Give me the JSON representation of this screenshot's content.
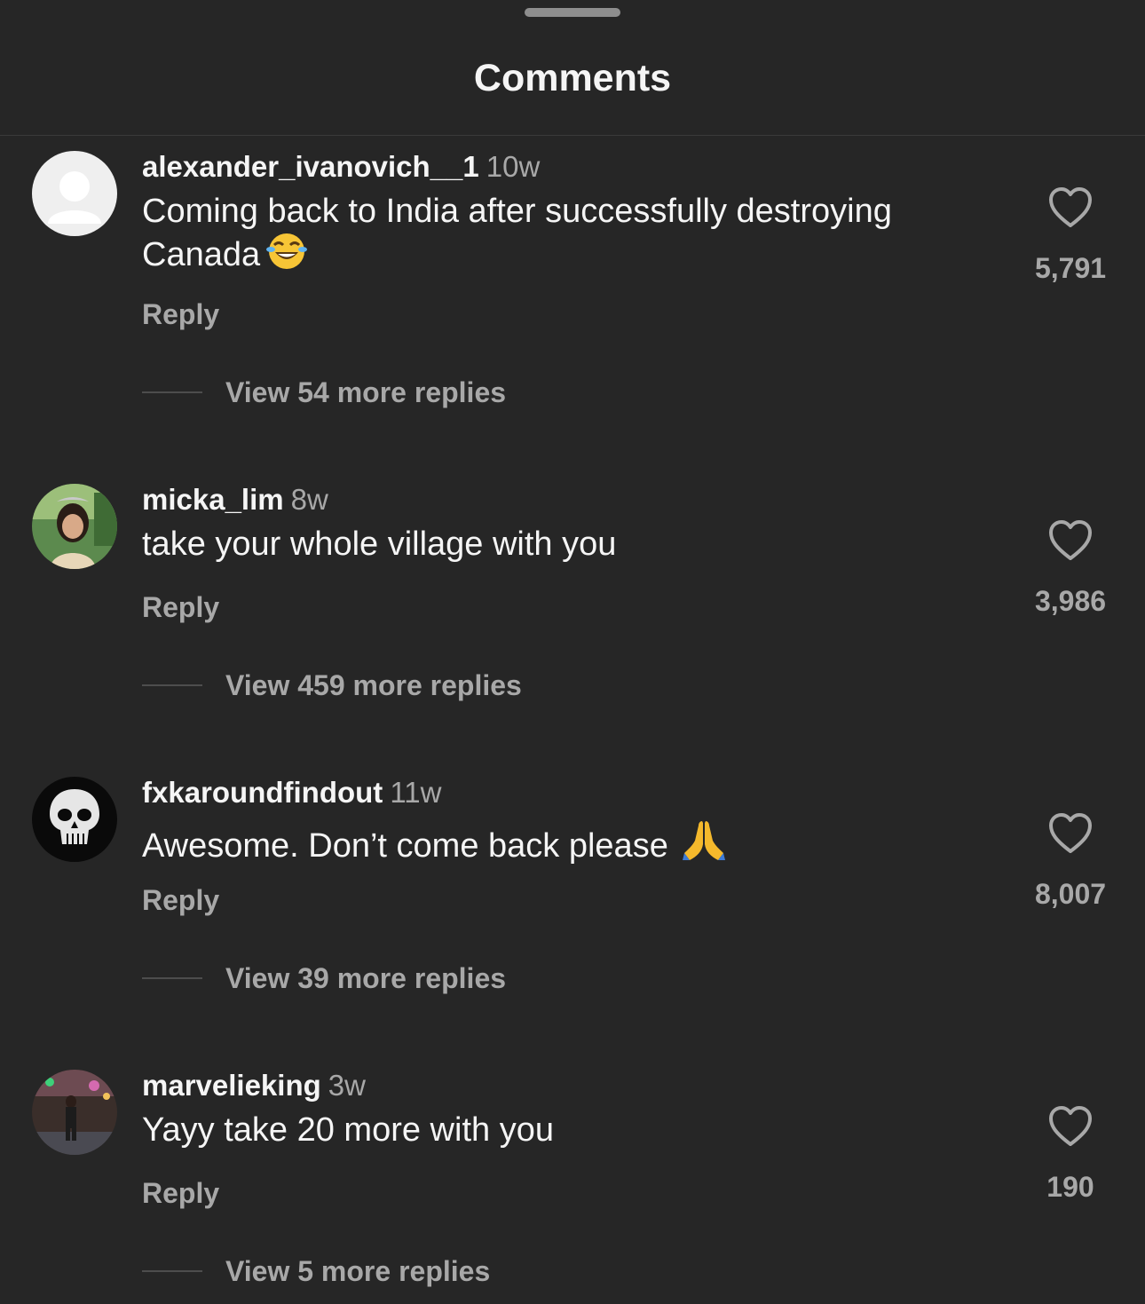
{
  "sheet": {
    "title": "Comments"
  },
  "colors": {
    "background": "#262626",
    "primary_text": "#f5f5f5",
    "secondary_text": "#a8a8a8",
    "divider": "#3a3a3a"
  },
  "comments": [
    {
      "username": "alexander_ivanovich__1",
      "time": "10w",
      "text": "Coming back to India after successfully destroying Canada",
      "emoji": "face-with-tears-of-joy",
      "reply_label": "Reply",
      "view_replies": "View 54 more replies",
      "likes": "5,791",
      "avatar": "default-avatar"
    },
    {
      "username": "micka_lim",
      "time": "8w",
      "text": "take your whole village with you",
      "reply_label": "Reply",
      "view_replies": "View 459 more replies",
      "likes": "3,986",
      "avatar": "photo-avatar"
    },
    {
      "username": "fxkaroundfindout",
      "time": "11w",
      "text": "Awesome. Don’t come back please",
      "emoji": "folded-hands",
      "reply_label": "Reply",
      "view_replies": "View 39 more replies",
      "likes": "8,007",
      "avatar": "skull-avatar"
    },
    {
      "username": "marvelieking",
      "time": "3w",
      "text": "Yayy take 20 more with you",
      "reply_label": "Reply",
      "view_replies": "View 5 more replies",
      "likes": "190",
      "avatar": "photo-avatar"
    }
  ]
}
